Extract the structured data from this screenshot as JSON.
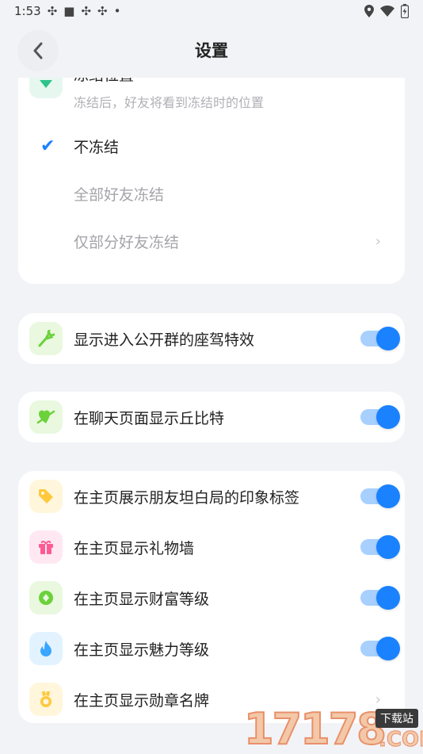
{
  "status": {
    "time": "1:53",
    "dot": "•",
    "left_icons": [
      "app-icon",
      "square-icon",
      "app-icon",
      "app-icon"
    ],
    "right_icons": [
      "location-icon",
      "wifi-icon",
      "battery-icon"
    ]
  },
  "header": {
    "title": "设置",
    "back_icon": "chevron-left-icon"
  },
  "freeze_card": {
    "title": "冻结位置",
    "subtitle": "冻结后，好友将看到冻结时的位置",
    "options": [
      {
        "label": "不冻结",
        "selected": true
      },
      {
        "label": "全部好友冻结",
        "selected": false
      },
      {
        "label": "仅部分好友冻结",
        "selected": false,
        "has_chevron": true
      }
    ]
  },
  "toggles": [
    {
      "label": "显示进入公开群的座驾特效",
      "on": true,
      "icon": "car-effect-icon",
      "icon_bg": "#e9f8df",
      "icon_color": "#6cd13a"
    },
    {
      "label": "在聊天页面显示丘比特",
      "on": true,
      "icon": "cupid-arrow-icon",
      "icon_bg": "#e9f8df",
      "icon_color": "#6cd13a"
    }
  ],
  "profile_card": {
    "items": [
      {
        "label": "在主页展示朋友坦白局的印象标签",
        "on": true,
        "icon": "tag-icon",
        "icon_bg": "#fff6dc",
        "icon_color": "#ffc93d"
      },
      {
        "label": "在主页显示礼物墙",
        "on": true,
        "icon": "gift-icon",
        "icon_bg": "#ffe8f1",
        "icon_color": "#ff5b93"
      },
      {
        "label": "在主页显示财富等级",
        "on": true,
        "icon": "diamond-icon",
        "icon_bg": "#e9f8df",
        "icon_color": "#6cd13a"
      },
      {
        "label": "在主页显示魅力等级",
        "on": true,
        "icon": "flame-icon",
        "icon_bg": "#e2f3ff",
        "icon_color": "#3aa6ff"
      },
      {
        "label": "在主页显示勋章名牌",
        "on": null,
        "icon": "medal-icon",
        "icon_bg": "#fff6dc",
        "icon_color": "#ffc93d"
      }
    ]
  },
  "watermark": {
    "number": "17178",
    "tag": "下载站",
    "domain": ".COM"
  },
  "colors": {
    "accent": "#1a82ff",
    "track": "#a8d0ff",
    "background": "#f2f3f7"
  }
}
